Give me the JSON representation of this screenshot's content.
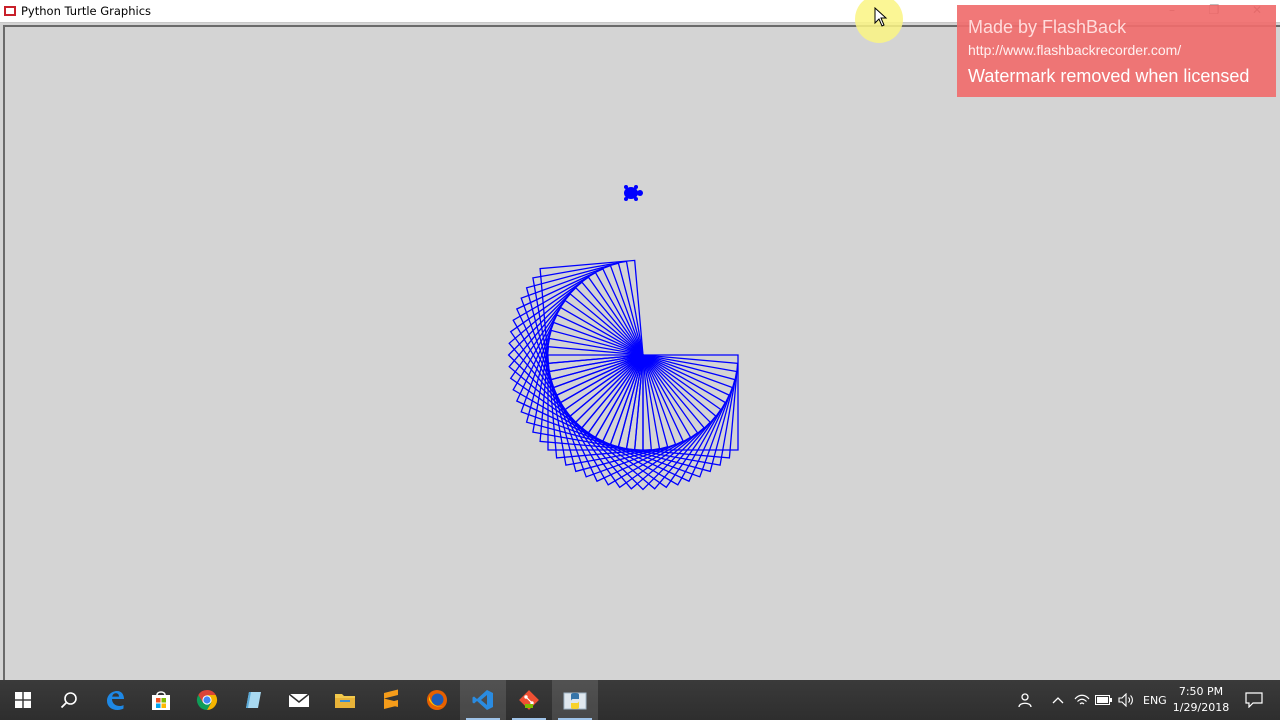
{
  "window": {
    "title": "Python Turtle Graphics",
    "minimize_label": "–",
    "restore_label": "❐",
    "close_label": "✕"
  },
  "canvas": {
    "background": "#d4d4d4",
    "pen_color": "#0000ff",
    "squares": 36,
    "turn_degrees": 5
  },
  "watermark": {
    "line1": "Made by FlashBack",
    "line2": "http://www.flashbackrecorder.com/",
    "line3": "Watermark removed when licensed"
  },
  "taskbar": {
    "icons": [
      "windows-start-icon",
      "search-icon",
      "edge-icon",
      "store-icon",
      "chrome-icon",
      "notepad-icon",
      "mail-icon",
      "file-explorer-icon",
      "sublime-text-icon",
      "firefox-icon",
      "visual-studio-icon",
      "git-icon",
      "python-idle-icon"
    ],
    "language": "ENG",
    "time": "7:50 PM",
    "date": "1/29/2018"
  }
}
